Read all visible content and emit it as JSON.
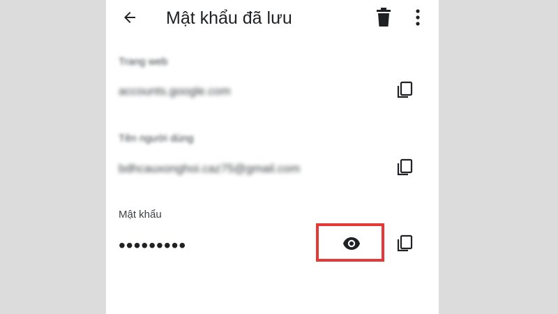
{
  "header": {
    "title": "Mật khẩu đã lưu",
    "back_icon": "arrow-left-icon",
    "delete_icon": "trash-icon",
    "more_icon": "more-vert-icon"
  },
  "fields": {
    "website": {
      "label": "Trang web",
      "value": "accounts.google.com"
    },
    "username": {
      "label": "Tên người dùng",
      "value": "bdhcauxonghoi.caz75@gmail.com"
    },
    "password": {
      "label": "Mật khẩu",
      "masked_value": "•••••••••"
    }
  },
  "icons": {
    "copy": "copy-icon",
    "reveal": "eye-icon"
  },
  "colors": {
    "highlight": "#e53935",
    "background": "#dcdcdc",
    "panel": "#ffffff"
  }
}
